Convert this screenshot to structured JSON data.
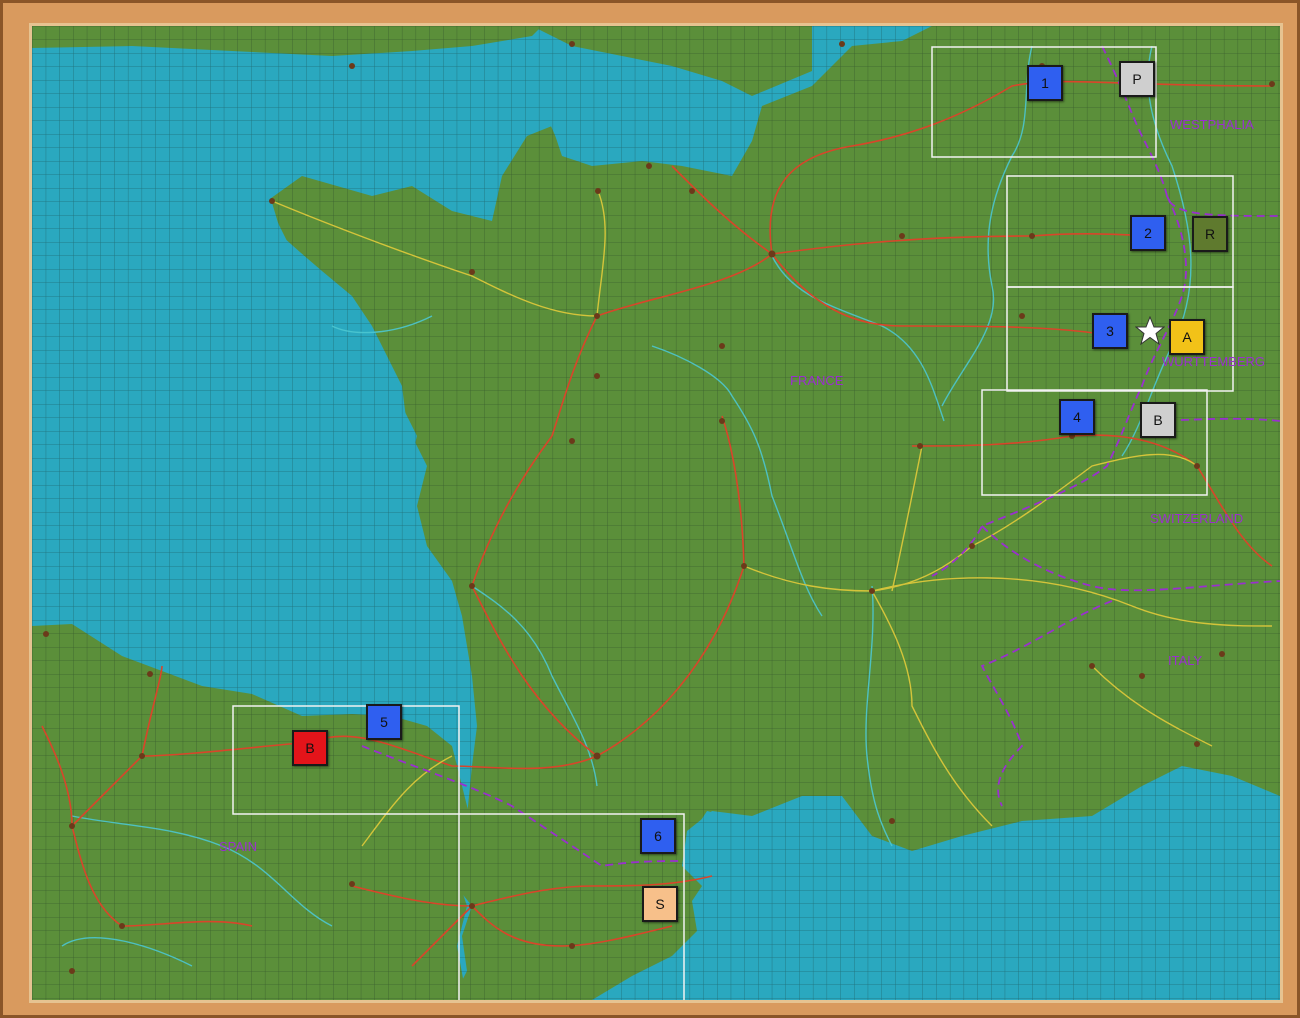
{
  "map": {
    "labels": {
      "westphalia": "WESTPHALIA",
      "france": "FRANCE",
      "wurttemberg": "WURTTEMBERG",
      "switzerland": "SWITZERLAND",
      "italy": "ITALY",
      "spain": "SPAIN"
    },
    "counters": {
      "c1": "1",
      "c2": "2",
      "c3": "3",
      "c4": "4",
      "c5": "5",
      "c6": "6",
      "prussia": "P",
      "russia": "R",
      "austria": "A",
      "bavaria": "B",
      "britain": "B",
      "spain": "S"
    },
    "colors": {
      "sea": "#2aa8bf",
      "land": "#5b8f3a",
      "french_counter": "#2f5ff0",
      "prussia_counter": "#cfcfcf",
      "russia_counter": "#5f7a2e",
      "austria_counter": "#f2c218",
      "bavaria_counter": "#cfcfcf",
      "britain_counter": "#e4141a",
      "spain_counter": "#f7c08a",
      "road": "#d9452a",
      "minor_road": "#d4c43a",
      "river": "#4cc6d0",
      "border": "#9a2fcf"
    },
    "icons": {
      "objective": "star-icon"
    }
  }
}
